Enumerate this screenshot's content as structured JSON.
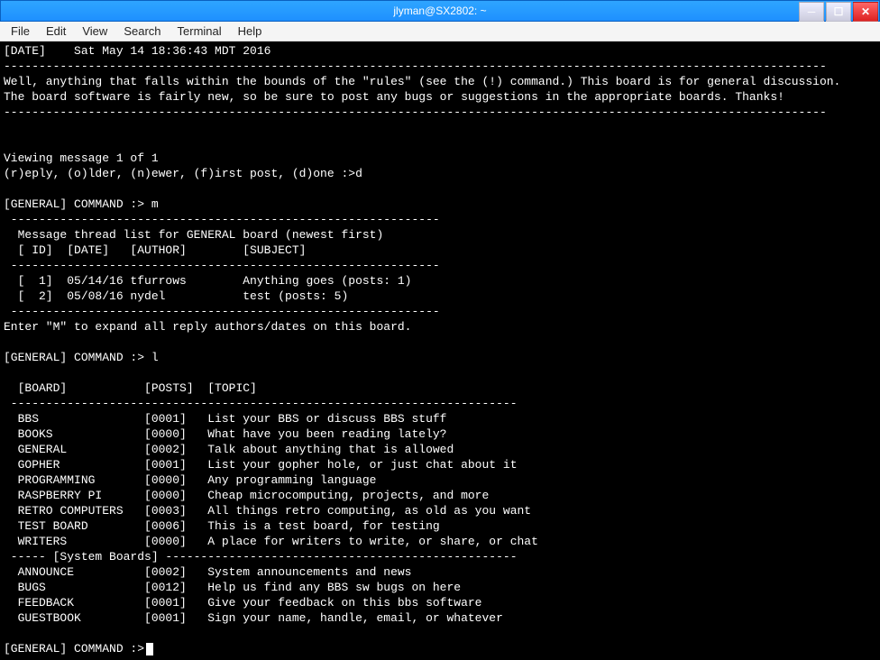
{
  "window": {
    "title": "jlyman@SX2802: ~"
  },
  "menu": {
    "items": [
      "File",
      "Edit",
      "View",
      "Search",
      "Terminal",
      "Help"
    ]
  },
  "term": {
    "date_line": "[DATE]    Sat May 14 18:36:43 MDT 2016",
    "dashes_long": "---------------------------------------------------------------------------------------------------------------------",
    "body1": "Well, anything that falls within the bounds of the \"rules\" (see the (!) command.) This board is for general discussion.",
    "body2": "The board software is fairly new, so be sure to post any bugs or suggestions in the appropriate boards. Thanks!",
    "view_msg": "Viewing message 1 of 1",
    "prompt_nav": "(r)eply, (o)lder, (n)ewer, (f)irst post, (d)one :>d",
    "cmd_m": "[GENERAL] COMMAND :> m",
    "dashes_med": " -------------------------------------------------------------",
    "thread_title": "  Message thread list for GENERAL board (newest first)",
    "thread_header": "  [ ID]  [DATE]   [AUTHOR]        [SUBJECT]",
    "thread_row1": "  [  1]  05/14/16 tfurrows        Anything goes (posts: 1)",
    "thread_row2": "  [  2]  05/08/16 nydel           test (posts: 5)",
    "expand_hint": "Enter \"M\" to expand all reply authors/dates on this board.",
    "cmd_l": "[GENERAL] COMMAND :> l",
    "board_header": "  [BOARD]           [POSTS]  [TOPIC]",
    "dashes_boards": " ------------------------------------------------------------------------",
    "boards": [
      "  BBS               [0001]   List your BBS or discuss BBS stuff",
      "  BOOKS             [0000]   What have you been reading lately?",
      "  GENERAL           [0002]   Talk about anything that is allowed",
      "  GOPHER            [0001]   List your gopher hole, or just chat about it",
      "  PROGRAMMING       [0000]   Any programming language",
      "  RASPBERRY PI      [0000]   Cheap microcomputing, projects, and more",
      "  RETRO COMPUTERS   [0003]   All things retro computing, as old as you want",
      "  TEST BOARD        [0006]   This is a test board, for testing",
      "  WRITERS           [0000]   A place for writers to write, or share, or chat"
    ],
    "sysboards_divider": " ----- [System Boards] --------------------------------------------------",
    "sysboards": [
      "  ANNOUNCE          [0002]   System announcements and news",
      "  BUGS              [0012]   Help us find any BBS sw bugs on here",
      "  FEEDBACK          [0001]   Give your feedback on this bbs software",
      "  GUESTBOOK         [0001]   Sign your name, handle, email, or whatever"
    ],
    "cmd_final": "[GENERAL] COMMAND :>"
  }
}
